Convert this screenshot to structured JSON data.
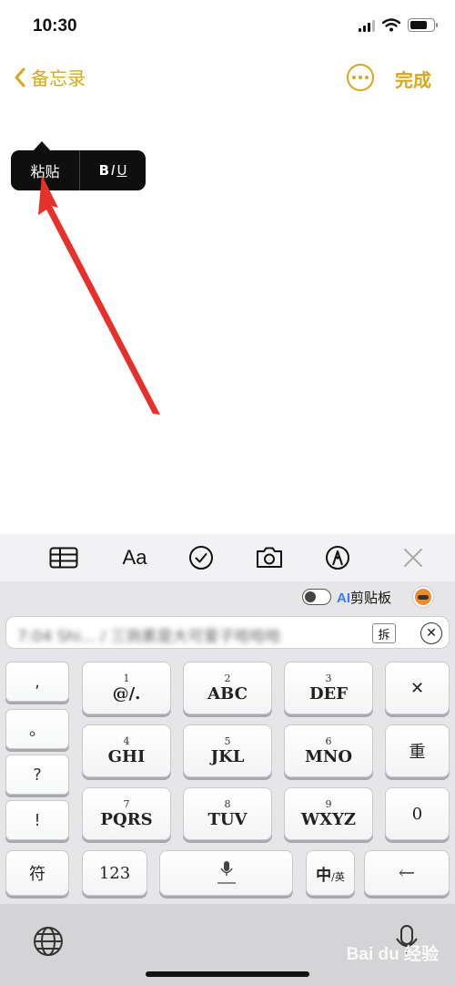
{
  "status_bar": {
    "time": "10:30",
    "battery_level": 0.75
  },
  "nav": {
    "back_label": "备忘录",
    "done_label": "完成"
  },
  "context_menu": {
    "paste_label": "粘贴",
    "bold_label": "B",
    "italic_label": "I",
    "underline_label": "U"
  },
  "notes_toolbar": {
    "icons": [
      "table-icon",
      "text-format-icon",
      "checklist-icon",
      "camera-icon",
      "markup-icon",
      "close-icon"
    ],
    "format_label": "Aa"
  },
  "keyboard": {
    "clipboard": {
      "ai_label": "AI",
      "clipboard_label": "剪贴板",
      "toggle_on": false
    },
    "candidate": {
      "text": "7:04 Shi... / 三驹素是大可爱子哈哈哈",
      "split_label": "拆",
      "clear_label": "✕"
    },
    "symbol_keys": [
      ",",
      "。",
      "?",
      "!"
    ],
    "keys": [
      {
        "num": "1",
        "label": "@/."
      },
      {
        "num": "2",
        "label": "ABC"
      },
      {
        "num": "3",
        "label": "DEF"
      },
      {
        "num": "4",
        "label": "GHI"
      },
      {
        "num": "5",
        "label": "JKL"
      },
      {
        "num": "6",
        "label": "MNO"
      },
      {
        "num": "7",
        "label": "PQRS"
      },
      {
        "num": "8",
        "label": "TUV"
      },
      {
        "num": "9",
        "label": "WXYZ"
      }
    ],
    "func_keys": {
      "delete": "✕",
      "retype": "重",
      "zero": "0",
      "symbols": "符",
      "numbers": "123",
      "lang_main": "中",
      "lang_sub": "/英",
      "enter": "←"
    }
  },
  "watermark": "Bai du 经验"
}
